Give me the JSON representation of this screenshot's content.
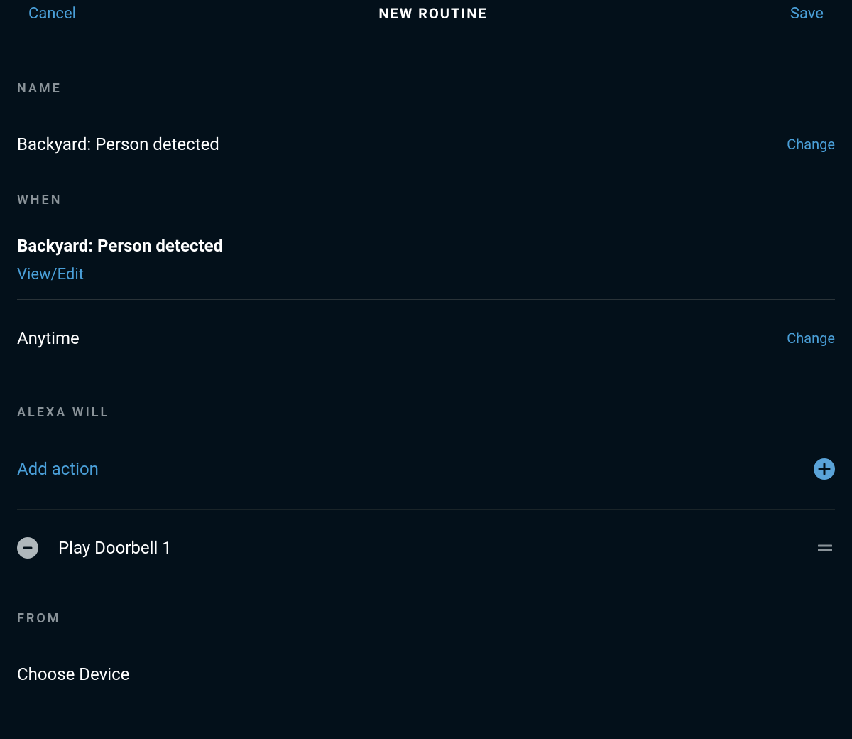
{
  "header": {
    "cancel": "Cancel",
    "title": "NEW ROUTINE",
    "save": "Save"
  },
  "sections": {
    "name": {
      "label": "NAME",
      "value": "Backyard: Person detected",
      "change": "Change"
    },
    "when": {
      "label": "WHEN",
      "trigger": "Backyard: Person detected",
      "viewEdit": "View/Edit",
      "time": "Anytime",
      "change": "Change"
    },
    "alexaWill": {
      "label": "ALEXA WILL",
      "addAction": "Add action",
      "actions": [
        {
          "label": "Play Doorbell 1"
        }
      ]
    },
    "from": {
      "label": "FROM",
      "chooseDevice": "Choose Device"
    }
  },
  "colors": {
    "background": "#03101a",
    "link": "#4a9fd8",
    "text": "#ffffff",
    "muted": "#8a9399",
    "divider": "#2a3338"
  }
}
